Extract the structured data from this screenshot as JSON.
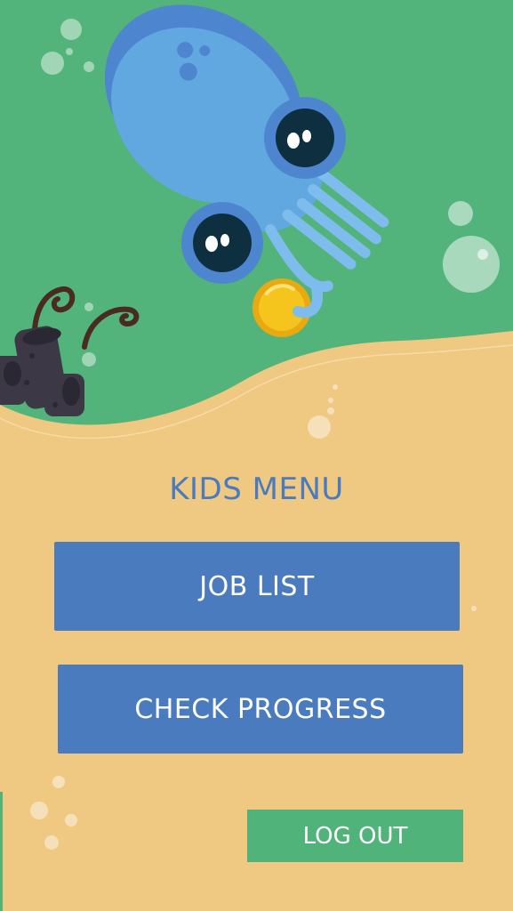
{
  "menu": {
    "title": "KIDS MENU",
    "job_list_label": "JOB LIST",
    "check_progress_label": "CHECK PROGRESS",
    "logout_label": "LOG OUT"
  },
  "colors": {
    "sea_green": "#52b47b",
    "sand": "#efc882",
    "button_blue": "#4a7bbf",
    "logout_green": "#4fb37a",
    "squid_blue": "#62a8e0",
    "coin_gold": "#f5c51e"
  },
  "icons": [
    "squid-illustration",
    "coin-icon",
    "coral-illustration",
    "bubble-icon"
  ]
}
